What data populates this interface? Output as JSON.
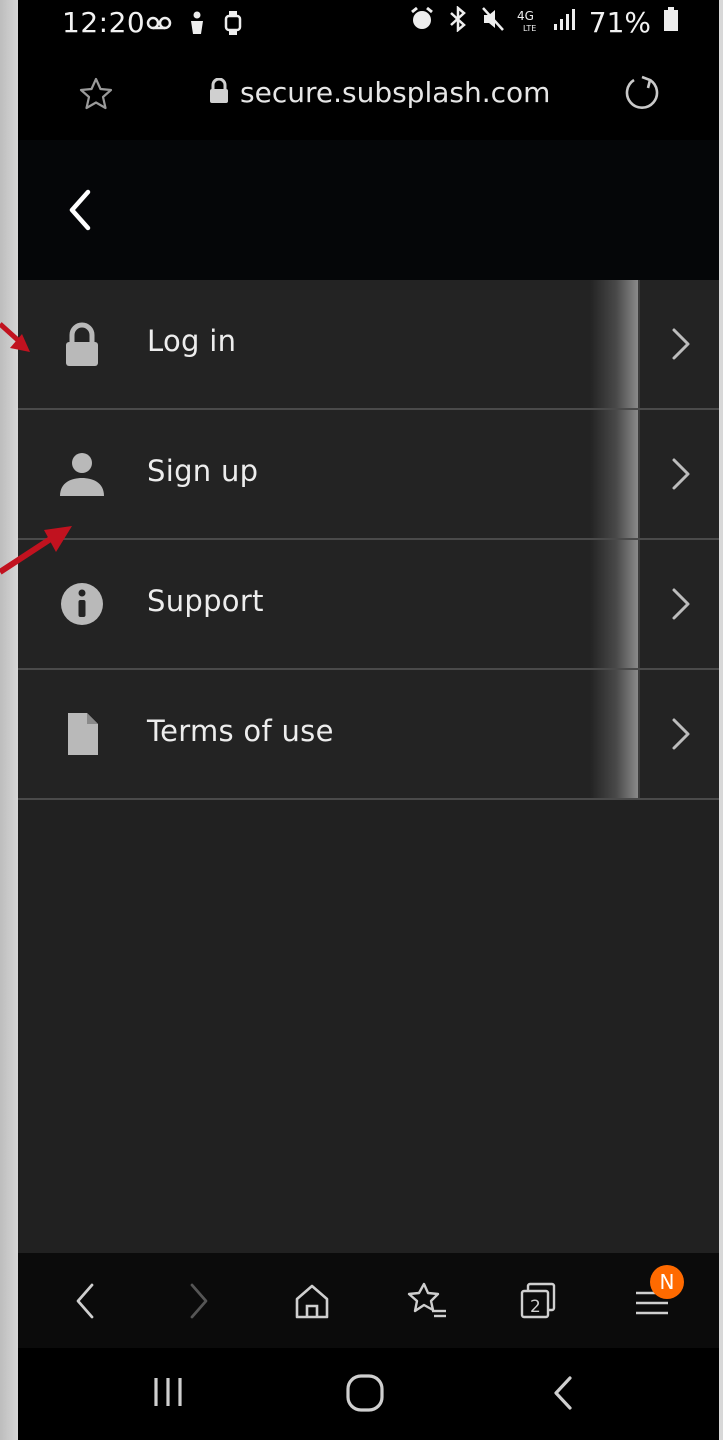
{
  "status_bar": {
    "time": "12:20",
    "battery": "71%",
    "icons": [
      "voicemail-icon",
      "accessibility-icon",
      "watch-icon",
      "alarm-icon",
      "bluetooth-icon",
      "mute-icon",
      "4g-lte-icon",
      "signal-icon",
      "battery-icon"
    ]
  },
  "url_bar": {
    "url": "secure.subsplash.com",
    "icons": [
      "bookmark-star-icon",
      "lock-icon",
      "reload-icon"
    ]
  },
  "header": {
    "back_icon": "chevron-left-icon"
  },
  "menu": {
    "items": [
      {
        "label": "Log in",
        "icon": "lock-icon"
      },
      {
        "label": "Sign up",
        "icon": "person-icon"
      },
      {
        "label": "Support",
        "icon": "info-icon"
      },
      {
        "label": "Terms of use",
        "icon": "document-icon"
      }
    ]
  },
  "browser_nav": {
    "tab_count": "2",
    "badge": "N",
    "badge_color": "#ff6a00",
    "icons": [
      "back-icon",
      "forward-icon",
      "home-icon",
      "bookmarks-icon",
      "tabs-icon",
      "menu-icon"
    ]
  },
  "system_nav": {
    "icons": [
      "recents-icon",
      "home-icon",
      "back-icon"
    ]
  },
  "colors": {
    "background": "#212121",
    "header": "#050608",
    "annotation_arrow": "#c1121f",
    "icon_gray": "#b9b9b9"
  }
}
